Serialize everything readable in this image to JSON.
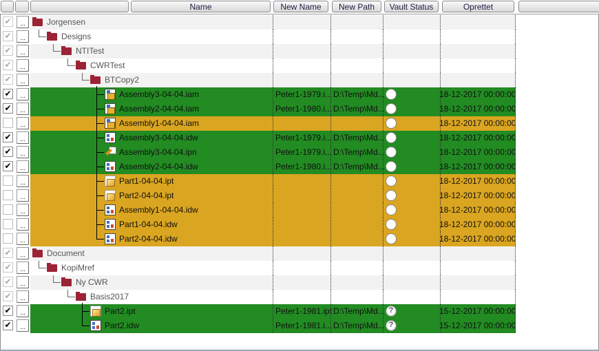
{
  "columns": [
    "",
    "",
    "",
    "Name",
    "New Name",
    "New Path",
    "Vault Status",
    "Oprettet",
    ""
  ],
  "colors": {
    "green": "#228B22",
    "orange": "#DAA520",
    "folder": "#9B2335",
    "grey_row": "#F2F2F2"
  },
  "rows": [
    {
      "name": "Jorgensen",
      "level": 0,
      "type": "folder",
      "checked": "grey"
    },
    {
      "name": "Designs",
      "level": 1,
      "type": "folder",
      "checked": "grey"
    },
    {
      "name": "NTITest",
      "level": 2,
      "type": "folder",
      "checked": "grey"
    },
    {
      "name": "CWRTest",
      "level": 3,
      "type": "folder",
      "checked": "grey"
    },
    {
      "name": "BTCopy2",
      "level": 4,
      "type": "folder",
      "checked": "grey"
    },
    {
      "name": "Assembly3-04-04.iam",
      "level": 5,
      "type": "iam",
      "checked": "black",
      "status": "green",
      "new_name": "Peter1-1979.i...",
      "new_path": "D:\\Temp\\Md...",
      "vault": "circle",
      "created": "18-12-2017 00:00:00"
    },
    {
      "name": "Assembly2-04-04.iam",
      "level": 5,
      "type": "iam",
      "checked": "black",
      "status": "green",
      "new_name": "Peter1-1980.i...",
      "new_path": "D:\\Temp\\Md...",
      "vault": "circle",
      "created": "18-12-2017 00:00:00"
    },
    {
      "name": "Assembly1-04-04.iam",
      "level": 5,
      "type": "iam",
      "checked": "none",
      "status": "orange",
      "new_name": "",
      "new_path": "",
      "vault": "circle",
      "created": "18-12-2017 00:00:00"
    },
    {
      "name": "Assembly3-04-04.idw",
      "level": 5,
      "type": "idw",
      "checked": "black",
      "status": "green",
      "new_name": "Peter1-1979.i...",
      "new_path": "D:\\Temp\\Md...",
      "vault": "circle",
      "created": "18-12-2017 00:00:00"
    },
    {
      "name": "Assembly3-04-04.ipn",
      "level": 5,
      "type": "ipn",
      "checked": "black",
      "status": "green",
      "new_name": "Peter1-1979.i...",
      "new_path": "D:\\Temp\\Md...",
      "vault": "circle",
      "created": "18-12-2017 00:00:00"
    },
    {
      "name": "Assembly2-04-04.idw",
      "level": 5,
      "type": "idw",
      "checked": "black",
      "status": "green",
      "new_name": "Peter1-1980.i...",
      "new_path": "D:\\Temp\\Md...",
      "vault": "circle",
      "created": "18-12-2017 00:00:00"
    },
    {
      "name": "Part1-04-04.ipt",
      "level": 5,
      "type": "ipt",
      "checked": "none",
      "status": "orange",
      "new_name": "",
      "new_path": "",
      "vault": "circle",
      "created": "18-12-2017 00:00:00"
    },
    {
      "name": "Part2-04-04.ipt",
      "level": 5,
      "type": "ipt",
      "checked": "none",
      "status": "orange",
      "new_name": "",
      "new_path": "",
      "vault": "circle",
      "created": "18-12-2017 00:00:00"
    },
    {
      "name": "Assembly1-04-04.idw",
      "level": 5,
      "type": "idw",
      "checked": "none",
      "status": "orange",
      "new_name": "",
      "new_path": "",
      "vault": "circle",
      "created": "18-12-2017 00:00:00"
    },
    {
      "name": "Part1-04-04.idw",
      "level": 5,
      "type": "idw",
      "checked": "none",
      "status": "orange",
      "new_name": "",
      "new_path": "",
      "vault": "circle",
      "created": "18-12-2017 00:00:00"
    },
    {
      "name": "Part2-04-04.idw",
      "level": 5,
      "type": "idw",
      "checked": "none",
      "status": "orange",
      "new_name": "",
      "new_path": "",
      "vault": "circle",
      "created": "18-12-2017 00:00:00",
      "last": true
    },
    {
      "name": "Document",
      "level": 0,
      "type": "folder",
      "checked": "grey"
    },
    {
      "name": "KopiMref",
      "level": 1,
      "type": "folder",
      "checked": "grey"
    },
    {
      "name": "Ny CWR",
      "level": 2,
      "type": "folder",
      "checked": "grey"
    },
    {
      "name": "Basis2017",
      "level": 3,
      "type": "folder",
      "checked": "grey"
    },
    {
      "name": "Part2.ipt",
      "level": 4,
      "type": "ipt",
      "checked": "black",
      "status": "green",
      "new_name": "Peter1-1981.ipt",
      "new_path": "D:\\Temp\\Md...",
      "vault": "question",
      "created": "15-12-2017 00:00:00"
    },
    {
      "name": "Part2.idw",
      "level": 4,
      "type": "idw",
      "checked": "black",
      "status": "green",
      "new_name": "Peter1-1981.i...",
      "new_path": "D:\\Temp\\Md...",
      "vault": "question",
      "created": "15-12-2017 00:00:00",
      "last": true
    }
  ],
  "dots_label": "...",
  "check_glyph": "✔",
  "question_glyph": "?"
}
